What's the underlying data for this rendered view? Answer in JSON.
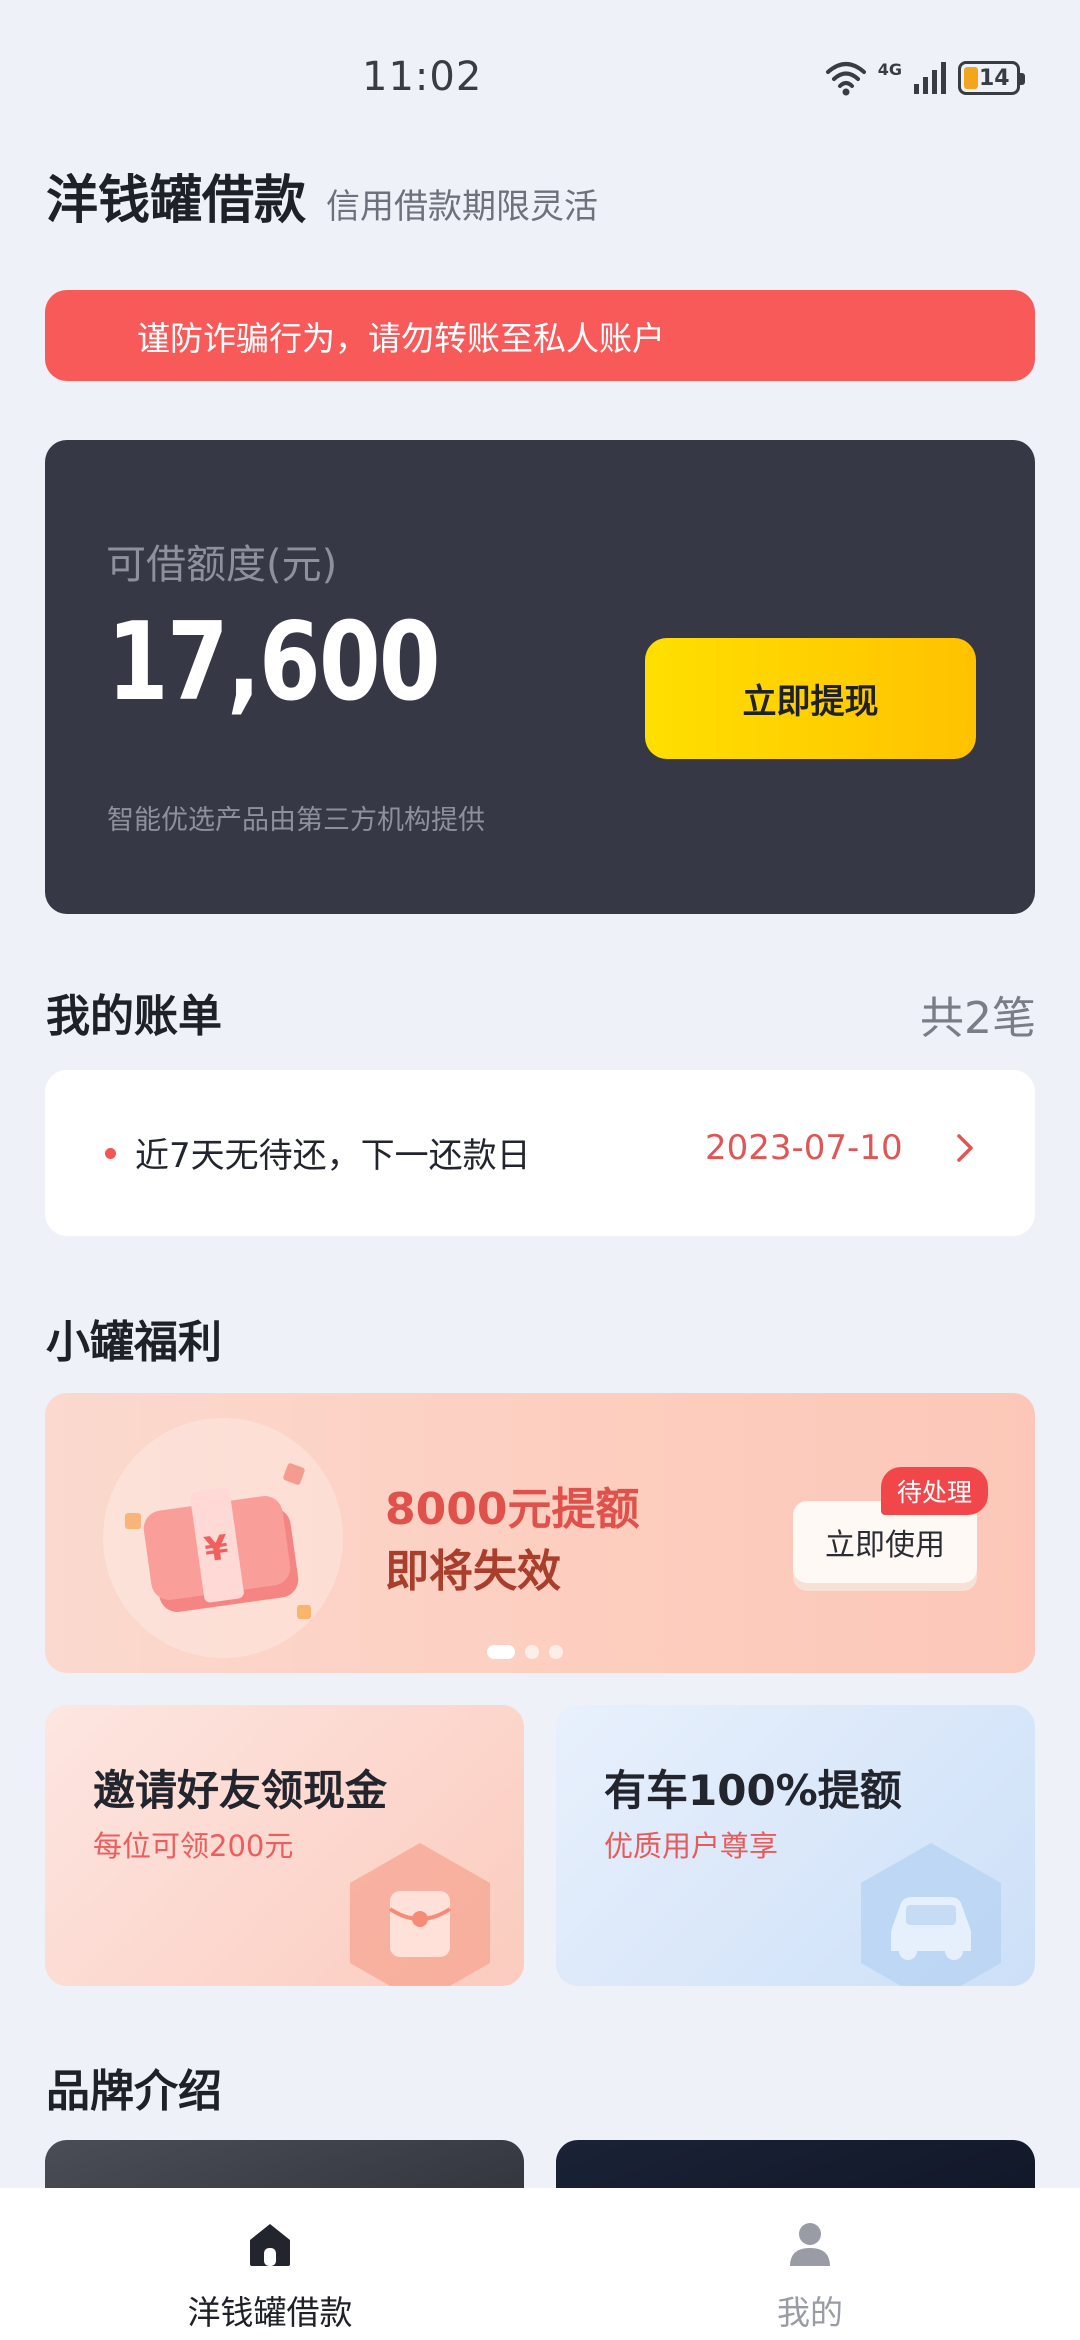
{
  "status_bar": {
    "time": "11:02",
    "network_type": "4G",
    "battery": "14",
    "battery_level_percent": 14
  },
  "header": {
    "title": "洋钱罐借款",
    "subtitle": "信用借款期限灵活"
  },
  "warning": {
    "text": "谨防诈骗行为，请勿转账至私人账户",
    "color": "#F85A5A"
  },
  "credit": {
    "label": "可借额度(元)",
    "amount": "17,600",
    "button_label": "立即提现",
    "note": "智能优选产品由第三方机构提供"
  },
  "bills": {
    "section_title": "我的账单",
    "count": "共2笔",
    "status_text": "近7天无待还，下一还款日",
    "next_date": "2023-07-10"
  },
  "benefits": {
    "section_title": "小罐福利",
    "promo": {
      "line1": "8000元提额",
      "line2": "即将失效",
      "button_label": "立即使用",
      "badge": "待处理",
      "icon": "money-stack-icon",
      "money_symbol": "¥"
    },
    "cards": [
      {
        "title": "邀请好友领现金",
        "subtitle": "每位可领200元",
        "icon": "red-envelope-icon"
      },
      {
        "title": "有车100%提额",
        "subtitle": "优质用户尊享",
        "icon": "car-icon"
      }
    ]
  },
  "brand": {
    "section_title": "品牌介绍"
  },
  "tab_bar": {
    "items": [
      {
        "label": "洋钱罐借款",
        "icon": "home-icon",
        "active": true
      },
      {
        "label": "我的",
        "icon": "user-icon",
        "active": false
      }
    ]
  },
  "colors": {
    "accent_yellow": "#FFC200",
    "alert_red": "#F85A5A",
    "dark_card": "#363845",
    "background": "#EEF1F8"
  }
}
